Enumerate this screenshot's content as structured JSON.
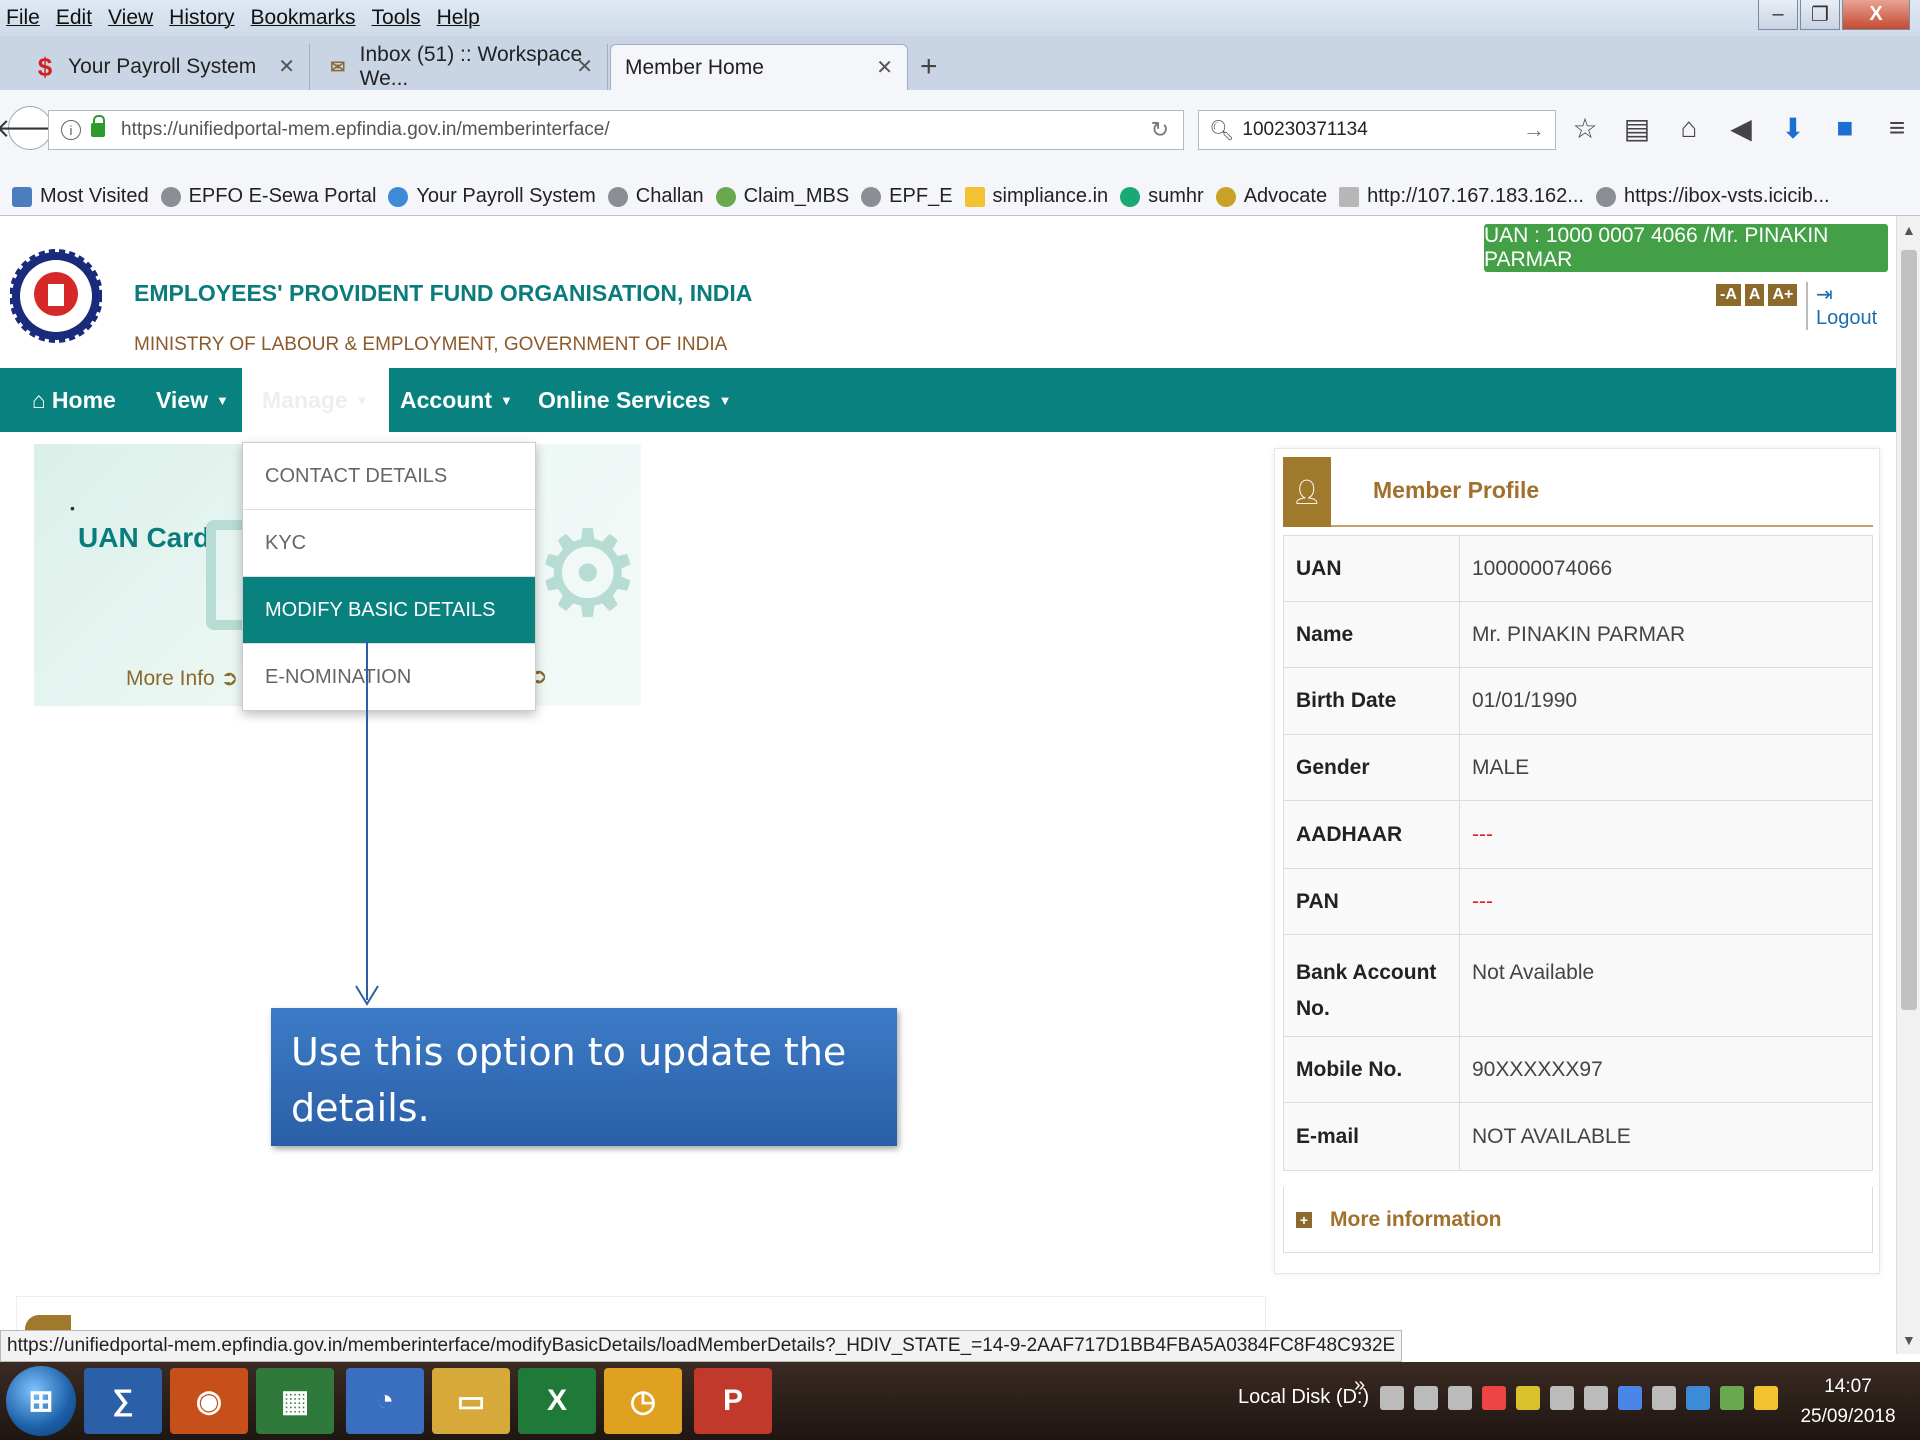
{
  "browser": {
    "menu": [
      "File",
      "Edit",
      "View",
      "History",
      "Bookmarks",
      "Tools",
      "Help"
    ],
    "window_controls": {
      "minimize": "–",
      "maximize": "❐",
      "close": "X"
    },
    "tabs": [
      {
        "label": "Your Payroll System",
        "icon": "payroll-icon"
      },
      {
        "label": "Inbox (51) :: Workspace We...",
        "icon": "mail-icon"
      },
      {
        "label": "Member Home",
        "icon": "none"
      }
    ],
    "new_tab": "+",
    "url": "https://unifiedportal-mem.epfindia.gov.in/memberinterface/",
    "search_value": "100230371134",
    "bookmarks": [
      "Most Visited",
      "EPFO E-Sewa Portal",
      "Your Payroll System",
      "Challan",
      "Claim_MBS",
      "EPF_E",
      "simpliance.in",
      "sumhr",
      "Advocate",
      "http://107.167.183.162...",
      "https://ibox-vsts.icicib..."
    ],
    "status_url": "https://unifiedportal-mem.epfindia.gov.in/memberinterface/modifyBasicDetails/loadMemberDetails?_HDIV_STATE_=14-9-2AAF717D1BB4FBA5A0384FC8F48C932E"
  },
  "header": {
    "org_name": "EMPLOYEES' PROVIDENT FUND ORGANISATION, INDIA",
    "ministry": "MINISTRY OF LABOUR & EMPLOYMENT, GOVERNMENT OF INDIA",
    "uan_badge": "UAN : 1000 0007 4066 /Mr. PINAKIN PARMAR",
    "font_buttons": [
      "-A",
      "A",
      "A+"
    ],
    "logout": "Logout"
  },
  "nav": {
    "home": "Home",
    "view": "View",
    "manage": "Manage",
    "account": "Account",
    "online_services": "Online Services"
  },
  "manage_dropdown": [
    "CONTACT DETAILS",
    "KYC",
    "MODIFY BASIC DETAILS",
    "E-NOMINATION"
  ],
  "uan_card": {
    "title": "UAN Card",
    "more_info": "More Info"
  },
  "callout": "Use this option to update the details.",
  "profile": {
    "title": "Member Profile",
    "rows": [
      {
        "key": "UAN",
        "value": "100000074066"
      },
      {
        "key": "Name",
        "value": "Mr. PINAKIN PARMAR"
      },
      {
        "key": "Birth Date",
        "value": "01/01/1990"
      },
      {
        "key": "Gender",
        "value": "MALE"
      },
      {
        "key": "AADHAAR",
        "value": "---"
      },
      {
        "key": "PAN",
        "value": "---"
      },
      {
        "key": "Bank Account No.",
        "value": "Not Available"
      },
      {
        "key": "Mobile No.",
        "value": "90XXXXXX97"
      },
      {
        "key": "E-mail",
        "value": "NOT AVAILABLE"
      }
    ],
    "more_information": "More information"
  },
  "taskbar": {
    "tray_label": "Local Disk (D:)",
    "time": "14:07",
    "date": "25/09/2018"
  },
  "colors": {
    "nav_teal": "#08817f",
    "brand_brown": "#a0702c",
    "badge_green": "#43a047",
    "callout_blue": "#2f68b0",
    "dash_red": "#dd2222"
  }
}
